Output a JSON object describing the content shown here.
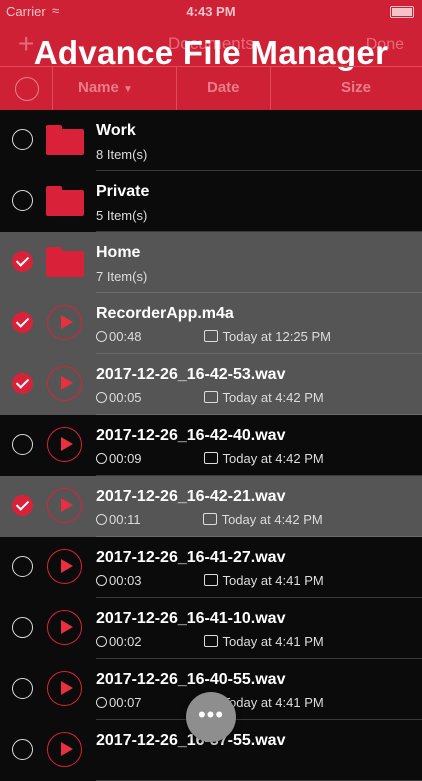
{
  "status": {
    "carrier": "Carrier",
    "time": "4:43 PM"
  },
  "nav": {
    "title": "Documents",
    "done": "Done",
    "add": "+"
  },
  "promo": {
    "title": "Advance File Manager"
  },
  "columns": {
    "name": "Name",
    "date": "Date",
    "size": "Size"
  },
  "rows": [
    {
      "type": "folder",
      "selected": false,
      "title": "Work",
      "subtitle": "8 Item(s)"
    },
    {
      "type": "folder",
      "selected": false,
      "title": "Private",
      "subtitle": "5 Item(s)"
    },
    {
      "type": "folder",
      "selected": true,
      "title": "Home",
      "subtitle": "7 Item(s)"
    },
    {
      "type": "audio",
      "selected": true,
      "title": "RecorderApp.m4a",
      "duration": "00:48",
      "date": "Today at 12:25 PM"
    },
    {
      "type": "audio",
      "selected": true,
      "title": "2017-12-26_16-42-53.wav",
      "duration": "00:05",
      "date": "Today at 4:42 PM"
    },
    {
      "type": "audio",
      "selected": false,
      "title": "2017-12-26_16-42-40.wav",
      "duration": "00:09",
      "date": "Today at 4:42 PM"
    },
    {
      "type": "audio",
      "selected": true,
      "title": "2017-12-26_16-42-21.wav",
      "duration": "00:11",
      "date": "Today at 4:42 PM"
    },
    {
      "type": "audio",
      "selected": false,
      "title": "2017-12-26_16-41-27.wav",
      "duration": "00:03",
      "date": "Today at 4:41 PM"
    },
    {
      "type": "audio",
      "selected": false,
      "title": "2017-12-26_16-41-10.wav",
      "duration": "00:02",
      "date": "Today at 4:41 PM"
    },
    {
      "type": "audio",
      "selected": false,
      "title": "2017-12-26_16-40-55.wav",
      "duration": "00:07",
      "date": "Today at 4:41 PM"
    },
    {
      "type": "audio",
      "selected": false,
      "title": "2017-12-26_16-37-55.wav",
      "duration": "",
      "date": ""
    }
  ],
  "fab": {
    "label": "•••"
  },
  "colors": {
    "accent": "#d9223a",
    "header": "#cf2135",
    "selected_row": "#555555"
  }
}
